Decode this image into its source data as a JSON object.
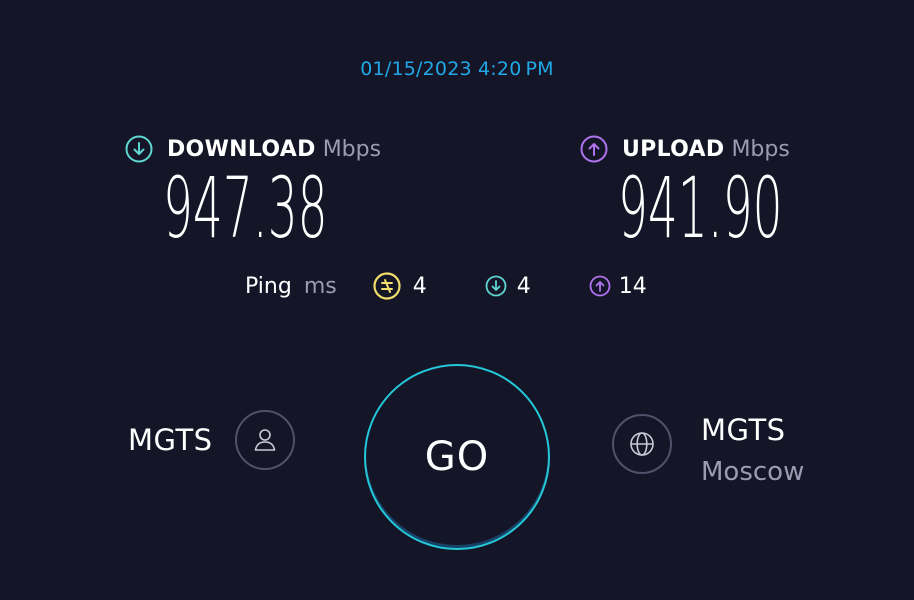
{
  "timestamp": "01/15/2023 4:20 PM",
  "download": {
    "label": "DOWNLOAD",
    "unit": "Mbps",
    "value": "947.38",
    "icon": "download-arrow-icon",
    "color": "#5fd6d0"
  },
  "upload": {
    "label": "UPLOAD",
    "unit": "Mbps",
    "value": "941.90",
    "icon": "upload-arrow-icon",
    "color": "#b073f0"
  },
  "ping": {
    "label": "Ping",
    "unit": "ms",
    "idle": {
      "value": "4",
      "icon": "idle-latency-icon",
      "color": "#f2de6b"
    },
    "download": {
      "value": "4",
      "icon": "download-latency-icon",
      "color": "#5fd6d0"
    },
    "upload": {
      "value": "14",
      "icon": "upload-latency-icon",
      "color": "#b073f0"
    }
  },
  "provider": {
    "name": "MGTS",
    "icon": "user-icon"
  },
  "go_button": {
    "label": "GO",
    "color": "#25c8d8"
  },
  "server": {
    "name": "MGTS",
    "city": "Moscow",
    "icon": "globe-icon"
  },
  "colors": {
    "background": "#141526",
    "accent": "#22a8e8",
    "muted": "#9b9bb3"
  }
}
